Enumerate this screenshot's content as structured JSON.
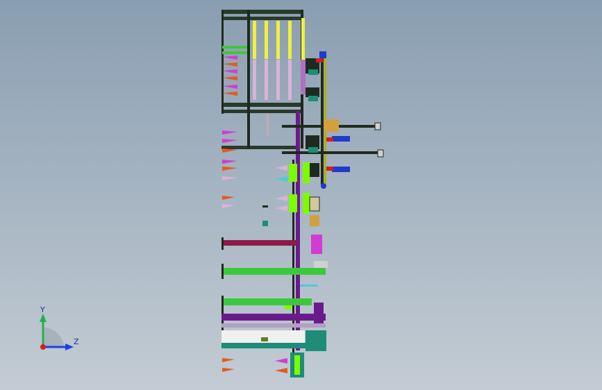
{
  "viewport": {
    "background_top": "#8a9eb1",
    "background_bottom": "#c3ccd4"
  },
  "triad": {
    "y_label": "Y",
    "z_label": "Z",
    "y_color": "#22b14c",
    "z_color": "#1d3fe0",
    "x_color": "#d42020"
  },
  "model": {
    "colors": {
      "frame": "#1e2a1e",
      "yellow": "#f0f03c",
      "pink": "#d9b3d9",
      "green": "#3cc83c",
      "bright_green": "#7cfc00",
      "purple": "#6b1a8c",
      "maroon": "#8c1a4a",
      "blue": "#1e3cc8",
      "red": "#d21e1e",
      "teal": "#1e8c78",
      "magenta": "#d23cd2",
      "orange": "#e65a1e",
      "cyan": "#50c8dc",
      "white": "#f0f0f0"
    }
  }
}
